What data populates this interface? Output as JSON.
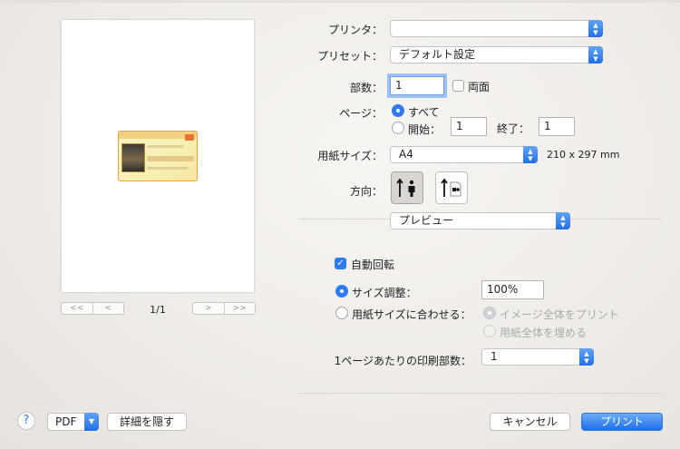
{
  "preview": {
    "page_indicator": "1/1",
    "nav_first": "<<",
    "nav_prev": "<",
    "nav_next": ">",
    "nav_last": ">>"
  },
  "form": {
    "printer_label": "プリンタ：",
    "printer_value": "",
    "preset_label": "プリセット：",
    "preset_value": "デフォルト設定",
    "copies_label": "部数：",
    "copies_value": "1",
    "duplex_label": "両面",
    "pages_label": "ページ：",
    "pages_all": "すべて",
    "pages_from_label": "開始：",
    "pages_from_value": "1",
    "pages_to_label": "終了：",
    "pages_to_value": "1",
    "paper_label": "用紙サイズ：",
    "paper_value": "A4",
    "paper_dims": "210 x 297 mm",
    "orientation_label": "方向：",
    "section_value": "プレビュー",
    "auto_rotate": "自動回転",
    "scale_label": "サイズ調整：",
    "scale_value": "100%",
    "fit_label": "用紙サイズに合わせる：",
    "fit_print_all": "イメージ全体をプリント",
    "fit_fill": "用紙全体を埋める",
    "per_page_label": "1ページあたりの印刷部数：",
    "per_page_value": "1"
  },
  "footer": {
    "help": "?",
    "pdf": "PDF",
    "hide_details": "詳細を隠す",
    "cancel": "キャンセル",
    "print": "プリント"
  },
  "colors": {
    "accent": "#2f7bf3"
  }
}
